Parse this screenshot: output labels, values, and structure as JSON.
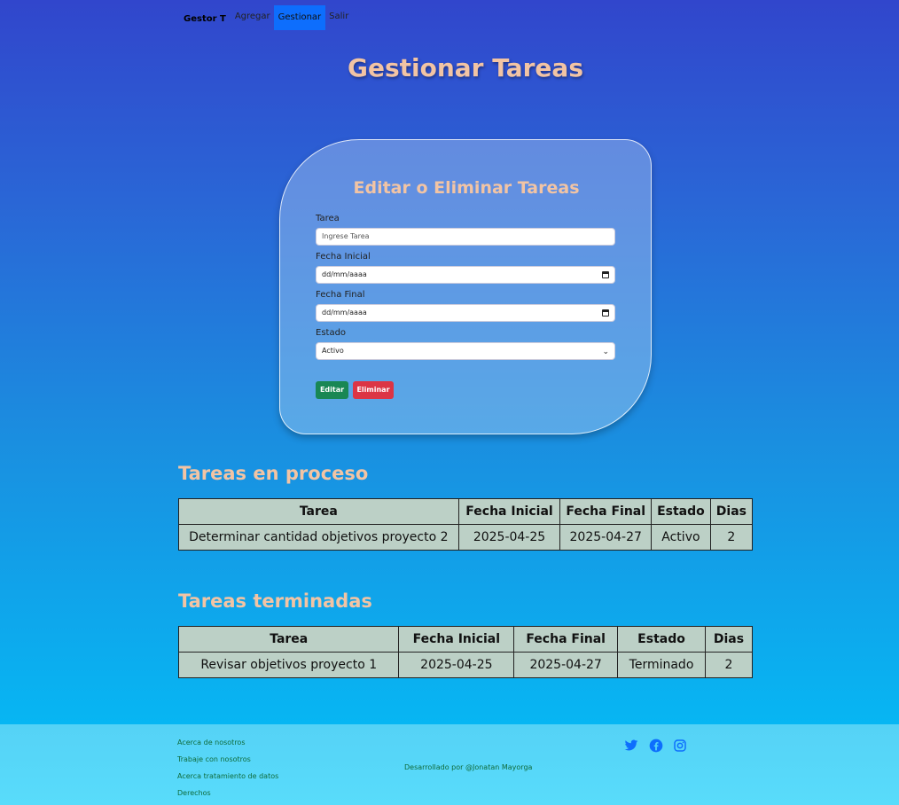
{
  "nav": {
    "brand": "Gestor T",
    "links": [
      {
        "label": "Agregar",
        "active": false
      },
      {
        "label": "Gestionar",
        "active": true
      },
      {
        "label": "Salir",
        "active": false
      }
    ]
  },
  "page_title": "Gestionar Tareas",
  "form": {
    "title": "Editar o Eliminar Tareas",
    "tarea_label": "Tarea",
    "tarea_placeholder": "Ingrese Tarea",
    "fecha_inicial_label": "Fecha Inicial",
    "fecha_inicial_value": "dd/mm/aaaa",
    "fecha_final_label": "Fecha Final",
    "fecha_final_value": "dd/mm/aaaa",
    "estado_label": "Estado",
    "estado_value": "Activo",
    "edit_button": "Editar",
    "delete_button": "Eliminar"
  },
  "en_proceso": {
    "title": "Tareas en proceso",
    "headers": [
      "Tarea",
      "Fecha Inicial",
      "Fecha Final",
      "Estado",
      "Dias"
    ],
    "rows": [
      [
        "Determinar cantidad objetivos proyecto 2",
        "2025-04-25",
        "2025-04-27",
        "Activo",
        "2"
      ]
    ]
  },
  "terminadas": {
    "title": "Tareas terminadas",
    "headers": [
      "Tarea",
      "Fecha Inicial",
      "Fecha Final",
      "Estado",
      "Dias"
    ],
    "rows": [
      [
        "Revisar objetivos proyecto 1",
        "2025-04-25",
        "2025-04-27",
        "Terminado",
        "2"
      ]
    ]
  },
  "footer": {
    "links": [
      "Acerca de nosotros",
      "Trabaje con nosotros",
      "Acerca tratamiento de datos",
      "Derechos"
    ],
    "credit": "Desarrollado por @Jonatan Mayorga",
    "social_icons": [
      "twitter-icon",
      "facebook-icon",
      "instagram-icon"
    ]
  },
  "colors": {
    "accent_title": "#f2c4a4",
    "nav_active": "#0d6efd",
    "button_edit": "#198754",
    "button_delete": "#dc3545",
    "table_bg": "#bcd0c6"
  }
}
